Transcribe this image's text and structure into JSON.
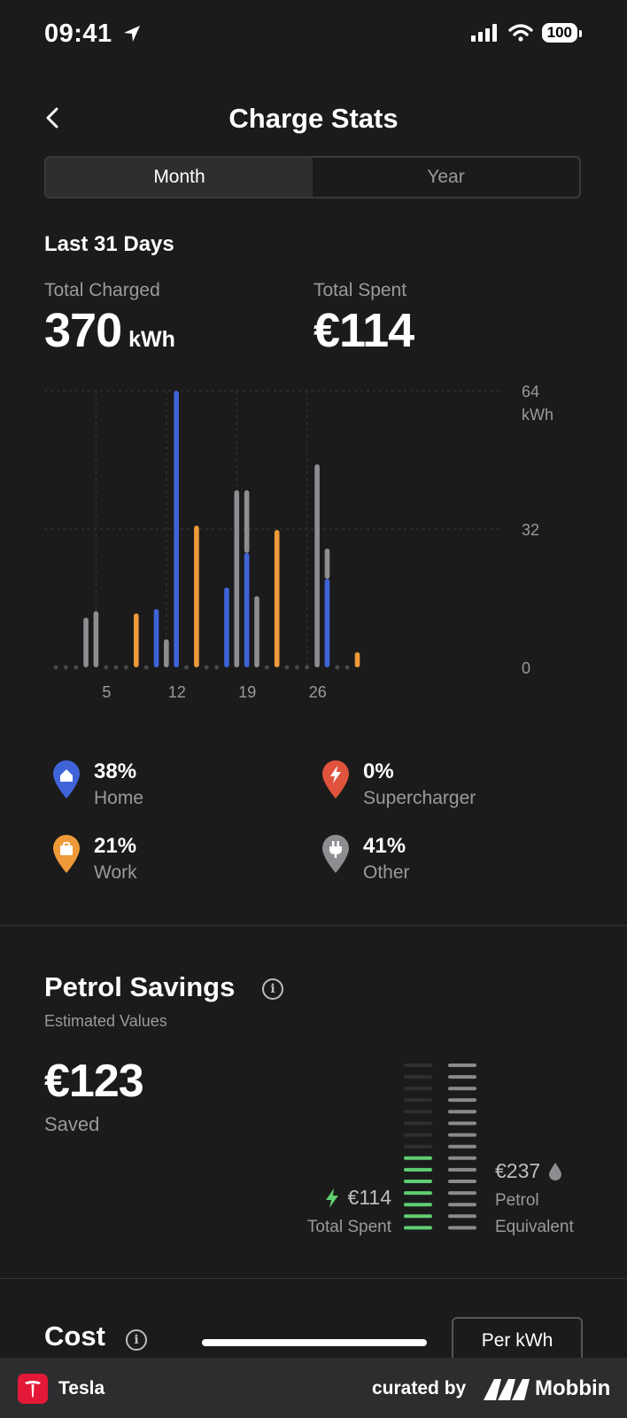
{
  "status_bar": {
    "time": "09:41",
    "battery": "100"
  },
  "header": {
    "title": "Charge Stats"
  },
  "tabs": [
    {
      "label": "Month",
      "active": true
    },
    {
      "label": "Year",
      "active": false
    }
  ],
  "period_title": "Last 31 Days",
  "totals": {
    "charged_label": "Total Charged",
    "charged_value": "370",
    "charged_unit": "kWh",
    "spent_label": "Total Spent",
    "spent_value": "€114"
  },
  "colors": {
    "home": "#3f63d8",
    "supercharger": "#e0533c",
    "work": "#ee9a38",
    "other": "#8e8e92",
    "petrol_green": "#5fcf72"
  },
  "chart_data": {
    "type": "bar",
    "x_ticks": [
      "5",
      "12",
      "19",
      "26"
    ],
    "y_ticks": [
      "64",
      "32",
      "0"
    ],
    "y_unit": "kWh",
    "ylim": [
      0,
      64
    ],
    "days": [
      1,
      2,
      3,
      4,
      5,
      6,
      7,
      8,
      9,
      10,
      11,
      12,
      13,
      14,
      15,
      16,
      17,
      18,
      19,
      20,
      21,
      22,
      23,
      24,
      25,
      26,
      27,
      28,
      29,
      30,
      31
    ],
    "series": [
      {
        "name": "Home",
        "color": "#3f63d8",
        "values": [
          0,
          0,
          0,
          0,
          0,
          0,
          0,
          0,
          0,
          0,
          13.5,
          0,
          64,
          0,
          0,
          0,
          0,
          18.5,
          0,
          26.5,
          0,
          0,
          0,
          0,
          0,
          0,
          0,
          20.5,
          0,
          0,
          0
        ]
      },
      {
        "name": "Work",
        "color": "#ee9a38",
        "values": [
          0,
          0,
          0,
          0,
          0,
          0,
          0,
          0,
          12.5,
          0,
          0,
          0,
          0,
          0,
          32.8,
          0,
          0,
          0,
          0,
          0,
          0,
          0,
          31.8,
          0,
          0,
          0,
          0,
          0,
          0,
          0,
          3.5
        ]
      },
      {
        "name": "Other",
        "color": "#8e8e92",
        "values": [
          0,
          0,
          0,
          11.5,
          13,
          0,
          0,
          0,
          0,
          0,
          0,
          6.5,
          0,
          0,
          0,
          0,
          0,
          0,
          41,
          14.5,
          16.5,
          0,
          0,
          0,
          0,
          0,
          47,
          7,
          0,
          0,
          0
        ]
      }
    ]
  },
  "legend": [
    {
      "pct": "38%",
      "name": "Home"
    },
    {
      "pct": "0%",
      "name": "Supercharger"
    },
    {
      "pct": "21%",
      "name": "Work"
    },
    {
      "pct": "41%",
      "name": "Other"
    }
  ],
  "petrol": {
    "title": "Petrol Savings",
    "subtitle": "Estimated Values",
    "saved_value": "€123",
    "saved_label": "Saved",
    "spent_value": "€114",
    "spent_label": "Total Spent",
    "petrol_value": "€237",
    "petrol_label": "Petrol Equivalent",
    "spent_level": 0.48,
    "petrol_level": 1.0
  },
  "cost": {
    "title": "Cost",
    "toggle_label": "Per kWh"
  },
  "footer": {
    "app_name": "Tesla",
    "curated_by": "curated by",
    "brand": "Mobbin"
  }
}
